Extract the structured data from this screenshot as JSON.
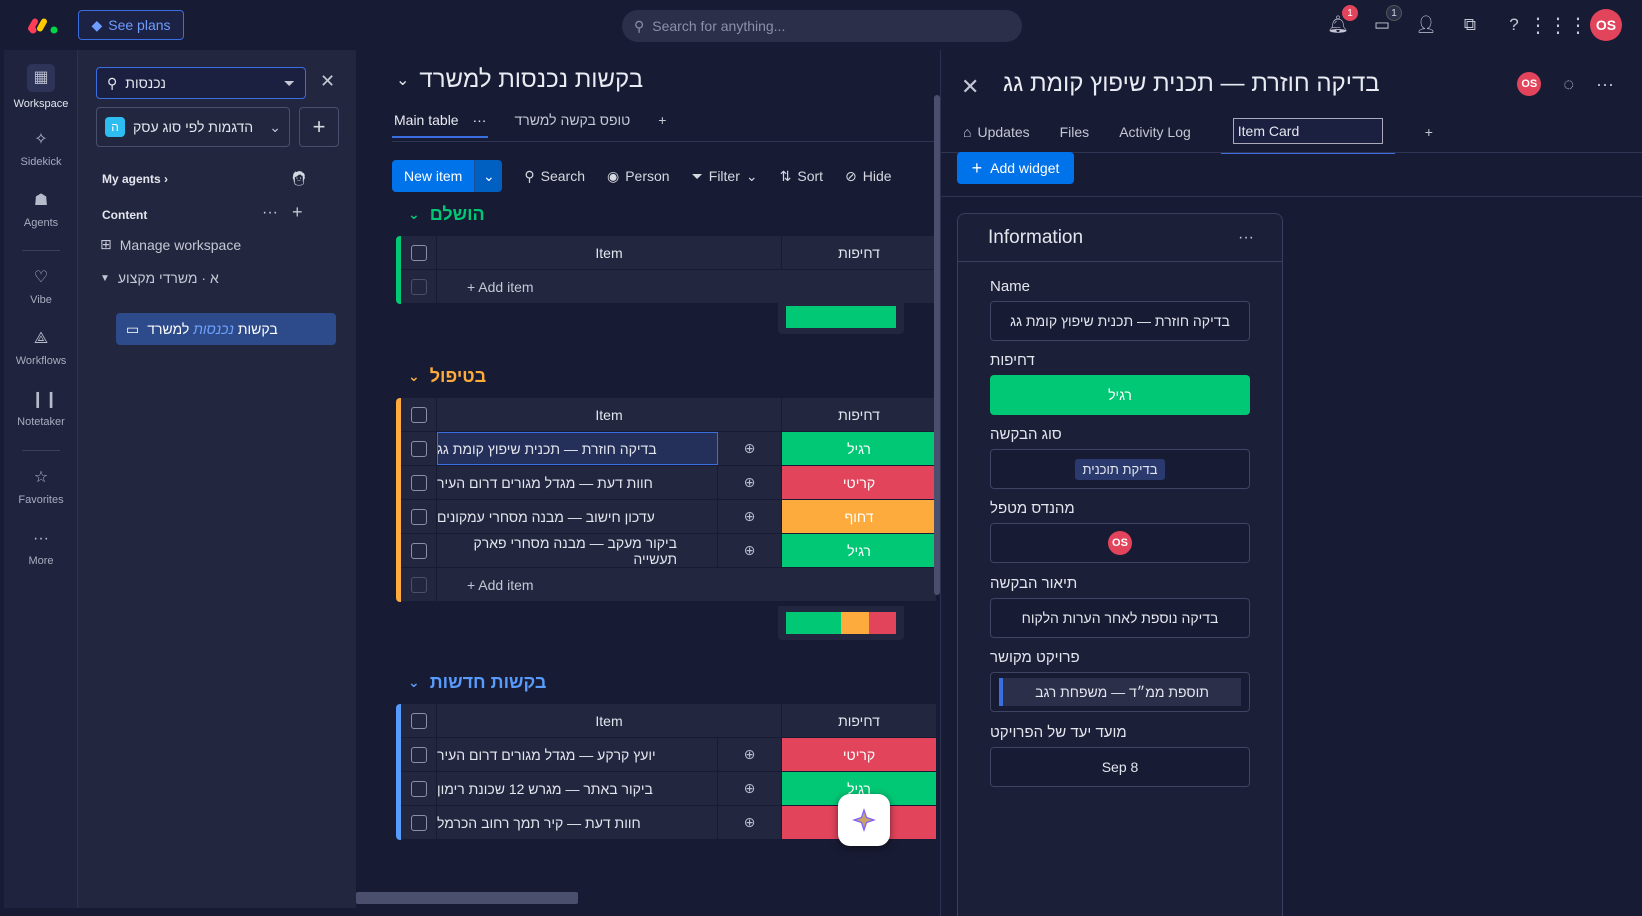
{
  "top": {
    "see_plans": "See plans",
    "search_placeholder": "Search for anything...",
    "notif_count": "1",
    "inbox_count": "1",
    "user_initials": "OS"
  },
  "leftnav": {
    "items": [
      {
        "label": "Workspace",
        "icon": "grid-icon"
      },
      {
        "label": "Sidekick",
        "icon": "sidekick-icon"
      },
      {
        "label": "Agents",
        "icon": "agents-icon"
      },
      {
        "label": "Vibe",
        "icon": "heart-icon"
      },
      {
        "label": "Workflows",
        "icon": "workflows-icon"
      },
      {
        "label": "Notetaker",
        "icon": "waveform-icon"
      },
      {
        "label": "Favorites",
        "icon": "star-icon"
      },
      {
        "label": "More",
        "icon": "more-icon"
      }
    ]
  },
  "sidebar": {
    "search_value": "נכנסות",
    "workspace_badge": "ה",
    "workspace_name": "הדגמות לפי סוג עסק",
    "my_agents": "My agents",
    "content": "Content",
    "manage_workspace": "Manage workspace",
    "folder": "א · משרדי מקצוע",
    "board_prefix": "בקשות",
    "board_highlight": "נכנסות",
    "board_suffix": "למשרד"
  },
  "board": {
    "title": "בקשות נכנסות למשרד",
    "tabs": [
      "Main table",
      "טופס בקשה למשרד"
    ],
    "toolbar": {
      "new_item": "New item",
      "search": "Search",
      "person": "Person",
      "filter": "Filter",
      "sort": "Sort",
      "hide": "Hide"
    },
    "col_item": "Item",
    "col_priority": "דחיפות",
    "add_item": "+ Add item",
    "groups": [
      {
        "title": "הושלם",
        "color": "#00c875",
        "rows": []
      },
      {
        "title": "בטיפול",
        "color": "#fdab3d",
        "rows": [
          {
            "name": "בדיקה חוזרת — תכנית שיפוץ קומת גג",
            "status": "רגיל",
            "color": "#00c875"
          },
          {
            "name": "חוות דעת — מגדל מגורים דרום העיר",
            "status": "קריטי",
            "color": "#e2445c"
          },
          {
            "name": "עדכון חישוב — מבנה מסחרי עמקונים",
            "status": "דחוף",
            "color": "#fdab3d"
          },
          {
            "name": "ביקור מעקב — מבנה מסחרי פארק תעשייה",
            "status": "רגיל",
            "color": "#00c875"
          }
        ]
      },
      {
        "title": "בקשות חדשות",
        "color": "#579bfc",
        "rows": [
          {
            "name": "יועץ קרקע — מגדל מגורים דרום העיר",
            "status": "קריטי",
            "color": "#e2445c"
          },
          {
            "name": "ביקור באתר — מגרש 12 שכונת רימון",
            "status": "רגיל",
            "color": "#00c875"
          },
          {
            "name": "חוות דעת — קיר תמך רחוב הכרמל",
            "status": "",
            "color": "#e2445c"
          }
        ]
      }
    ]
  },
  "panel": {
    "title": "בדיקה חוזרת — תכנית שיפוץ קומת גג",
    "tabs": [
      "Updates",
      "Files",
      "Activity Log"
    ],
    "active_tab_value": "Item Card",
    "add_widget": "Add widget",
    "widget_title": "Information",
    "fields": {
      "name_label": "Name",
      "name_value": "בדיקה חוזרת — תכנית שיפוץ קומת גג",
      "priority_label": "דחיפות",
      "priority_value": "רגיל",
      "type_label": "סוג הבקשה",
      "type_value": "בדיקת תוכנית",
      "engineer_label": "מהנדס מטפל",
      "engineer_initials": "OS",
      "desc_label": "תיאור הבקשה",
      "desc_value": "בדיקה נוספת לאחר הערות הלקוח",
      "project_label": "פרויקט מקושר",
      "project_value": "תוספת ממ״ד — משפחת רגב",
      "deadline_label": "מועד יעד של הפרויקט",
      "deadline_value": "8 Sep"
    }
  }
}
